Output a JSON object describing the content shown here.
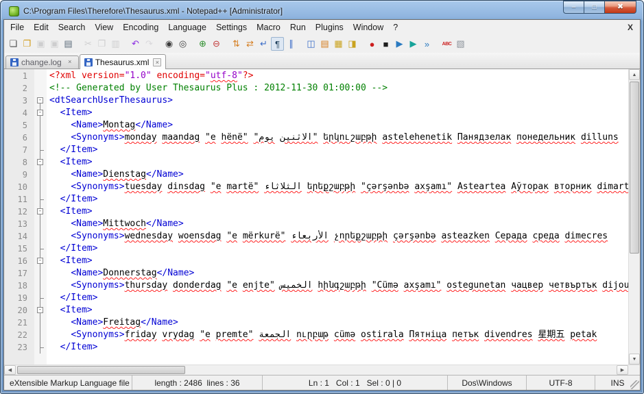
{
  "window": {
    "title": "C:\\Program Files\\Therefore\\Thesaurus.xml - Notepad++ [Administrator]"
  },
  "titlebar": {
    "buttons": [
      {
        "name": "minimize-button",
        "glyph": "–",
        "cls": "min"
      },
      {
        "name": "maximize-button",
        "glyph": "□",
        "cls": "max"
      },
      {
        "name": "close-button",
        "glyph": "✖",
        "cls": "close"
      }
    ]
  },
  "menu": {
    "items": [
      "File",
      "Edit",
      "Search",
      "View",
      "Encoding",
      "Language",
      "Settings",
      "Macro",
      "Run",
      "Plugins",
      "Window",
      "?"
    ],
    "close_document_label": "X"
  },
  "toolbar": {
    "icons": [
      {
        "n": "new-file-icon",
        "g": "❏",
        "c": "#4a4a4a"
      },
      {
        "n": "open-folder-icon",
        "g": "❐",
        "c": "#d29b18"
      },
      {
        "n": "save-icon",
        "g": "▣",
        "c": "#9aa2ac",
        "d": 1
      },
      {
        "n": "save-all-icon",
        "g": "▣",
        "c": "#9aa2ac",
        "d": 1
      },
      {
        "n": "print-icon",
        "g": "▤",
        "c": "#5d6d7c"
      },
      {
        "sep": 1
      },
      {
        "n": "cut-icon",
        "g": "✂",
        "c": "#9aa2ac",
        "d": 1
      },
      {
        "n": "copy-icon",
        "g": "❐",
        "c": "#9aa2ac",
        "d": 1
      },
      {
        "n": "paste-icon",
        "g": "▥",
        "c": "#9aa2ac",
        "d": 1
      },
      {
        "sep": 1
      },
      {
        "n": "undo-icon",
        "g": "↶",
        "c": "#8a2be2"
      },
      {
        "n": "redo-icon",
        "g": "↷",
        "c": "#c5b3e6",
        "d": 1
      },
      {
        "sep": 1
      },
      {
        "n": "find-icon",
        "g": "◉",
        "c": "#3b3b3b"
      },
      {
        "n": "replace-icon",
        "g": "◎",
        "c": "#3b3b3b"
      },
      {
        "sep": 1
      },
      {
        "n": "zoom-in-icon",
        "g": "⊕",
        "c": "#2f8f2f"
      },
      {
        "n": "zoom-out-icon",
        "g": "⊖",
        "c": "#c23a3a"
      },
      {
        "sep": 1
      },
      {
        "n": "sync-vertical-scroll-icon",
        "g": "⇅",
        "c": "#d57d1f"
      },
      {
        "n": "sync-horizontal-scroll-icon",
        "g": "⇄",
        "c": "#d57d1f"
      },
      {
        "n": "word-wrap-icon",
        "g": "↵",
        "c": "#3a6cc8"
      },
      {
        "n": "show-all-characters-icon",
        "g": "¶",
        "c": "#23425e",
        "p": 1
      },
      {
        "n": "indent-guide-icon",
        "g": "∥",
        "c": "#3a6cc8"
      },
      {
        "sep": 1
      },
      {
        "n": "doc-map-icon",
        "g": "◫",
        "c": "#3a6cc8"
      },
      {
        "n": "function-list-icon",
        "g": "▤",
        "c": "#d57d1f"
      },
      {
        "n": "file-browser-icon",
        "g": "▦",
        "c": "#caa31e"
      },
      {
        "n": "monitor-icon",
        "g": "◨",
        "c": "#caa31e"
      },
      {
        "sep": 1
      },
      {
        "n": "record-macro-icon",
        "g": "●",
        "c": "#cc1f1f"
      },
      {
        "n": "stop-macro-icon",
        "g": "■",
        "c": "#1f1f1f"
      },
      {
        "n": "play-macro-icon",
        "g": "▶",
        "c": "#2a7ac0"
      },
      {
        "n": "save-macro-icon",
        "g": "▶",
        "c": "#18a39a"
      },
      {
        "n": "run-macro-multiple-icon",
        "g": "»",
        "c": "#2a7ac0"
      },
      {
        "sep": 1
      },
      {
        "n": "spell-check-icon",
        "g": "ABC",
        "c": "#cc1f1f",
        "abc": 1
      },
      {
        "n": "plugin-icon",
        "g": "▧",
        "c": "#8d949c"
      }
    ]
  },
  "tabs": {
    "close_glyph": "×",
    "items": [
      {
        "label": "change.log",
        "active": false
      },
      {
        "label": "Thesaurus.xml",
        "active": true
      }
    ]
  },
  "scrollbar": {
    "up": "▲",
    "down": "▼",
    "left": "◀",
    "right": "▶"
  },
  "editor": {
    "lines": [
      {
        "n": 1,
        "f": "",
        "seg": [
          {
            "s": "dec",
            "t": "<?xml version="
          },
          {
            "s": "str",
            "t": "\"1.0\""
          },
          {
            "s": "dec",
            "t": " encoding="
          },
          {
            "s": "str",
            "t": "\""
          },
          {
            "s": "strm",
            "t": "utf-8"
          },
          {
            "s": "str",
            "t": "\""
          },
          {
            "s": "dec",
            "t": "?>"
          }
        ]
      },
      {
        "n": 2,
        "f": "",
        "seg": [
          {
            "s": "com",
            "t": "<!-- Generated by User Thesaurus Plus : 2012-11-30 01:00:00 -->"
          }
        ]
      },
      {
        "n": 3,
        "f": "boxtop",
        "seg": [
          {
            "s": "tag",
            "t": "<dtSearchUserThesaurus>"
          }
        ]
      },
      {
        "n": 4,
        "f": "box",
        "seg": [
          {
            "s": "txt",
            "t": "  "
          },
          {
            "s": "tag",
            "t": "<Item>"
          }
        ]
      },
      {
        "n": 5,
        "f": "line",
        "seg": [
          {
            "s": "txt",
            "t": "    "
          },
          {
            "s": "tag",
            "t": "<Name>"
          },
          {
            "s": "mis",
            "t": "Montag"
          },
          {
            "s": "tag",
            "t": "</Name>"
          }
        ]
      },
      {
        "n": 6,
        "f": "line",
        "seg": [
          {
            "s": "txt",
            "t": "    "
          },
          {
            "s": "tag",
            "t": "<Synonyms>"
          },
          {
            "s": "mis",
            "t": "monday maandag \"e hënë\" \"يوم الاثنين\" երկուշաբթի astelehenetik Панядзелак понедельник dilluns"
          }
        ]
      },
      {
        "n": 7,
        "f": "end",
        "seg": [
          {
            "s": "txt",
            "t": "  "
          },
          {
            "s": "tag",
            "t": "</Item>"
          }
        ]
      },
      {
        "n": 8,
        "f": "box",
        "seg": [
          {
            "s": "txt",
            "t": "  "
          },
          {
            "s": "tag",
            "t": "<Item>"
          }
        ]
      },
      {
        "n": 9,
        "f": "line",
        "seg": [
          {
            "s": "txt",
            "t": "    "
          },
          {
            "s": "tag",
            "t": "<Name>"
          },
          {
            "s": "mis",
            "t": "Dienstag"
          },
          {
            "s": "tag",
            "t": "</Name>"
          }
        ]
      },
      {
        "n": 10,
        "f": "line",
        "seg": [
          {
            "s": "txt",
            "t": "    "
          },
          {
            "s": "tag",
            "t": "<Synonyms>"
          },
          {
            "s": "mis",
            "t": "tuesday dinsdag \"e martë\" الثلاثاء երեքշաբթի \"çərşənbə axşamı\" Asteartea Аўторак вторник dimarts"
          }
        ]
      },
      {
        "n": 11,
        "f": "end",
        "seg": [
          {
            "s": "txt",
            "t": "  "
          },
          {
            "s": "tag",
            "t": "</Item>"
          }
        ]
      },
      {
        "n": 12,
        "f": "box",
        "seg": [
          {
            "s": "txt",
            "t": "  "
          },
          {
            "s": "tag",
            "t": "<Item>"
          }
        ]
      },
      {
        "n": 13,
        "f": "line",
        "seg": [
          {
            "s": "txt",
            "t": "    "
          },
          {
            "s": "tag",
            "t": "<Name>"
          },
          {
            "s": "mis",
            "t": "Mittwoch"
          },
          {
            "s": "tag",
            "t": "</Name>"
          }
        ]
      },
      {
        "n": 14,
        "f": "line",
        "seg": [
          {
            "s": "txt",
            "t": "    "
          },
          {
            "s": "tag",
            "t": "<Synonyms>"
          },
          {
            "s": "mis",
            "t": "wednesday woensdag \"e mërkurë\" الأربعاء չորեքշաբթի çərşənbə asteazken Серада среда dimecres"
          }
        ]
      },
      {
        "n": 15,
        "f": "end",
        "seg": [
          {
            "s": "txt",
            "t": "  "
          },
          {
            "s": "tag",
            "t": "</Item>"
          }
        ]
      },
      {
        "n": 16,
        "f": "box",
        "seg": [
          {
            "s": "txt",
            "t": "  "
          },
          {
            "s": "tag",
            "t": "<Item>"
          }
        ]
      },
      {
        "n": 17,
        "f": "line",
        "seg": [
          {
            "s": "txt",
            "t": "    "
          },
          {
            "s": "tag",
            "t": "<Name>"
          },
          {
            "s": "mis",
            "t": "Donnerstag"
          },
          {
            "s": "tag",
            "t": "</Name>"
          }
        ]
      },
      {
        "n": 18,
        "f": "line",
        "seg": [
          {
            "s": "txt",
            "t": "    "
          },
          {
            "s": "tag",
            "t": "<Synonyms>"
          },
          {
            "s": "mis",
            "t": "thursday donderdag \"e enjte\" الخميس հինգշաբթի \"Cümə axşamı\" ostegunetan чацвер четвъртък dijous"
          }
        ]
      },
      {
        "n": 19,
        "f": "end",
        "seg": [
          {
            "s": "txt",
            "t": "  "
          },
          {
            "s": "tag",
            "t": "</Item>"
          }
        ]
      },
      {
        "n": 20,
        "f": "box",
        "seg": [
          {
            "s": "txt",
            "t": "  "
          },
          {
            "s": "tag",
            "t": "<Item>"
          }
        ]
      },
      {
        "n": 21,
        "f": "line",
        "seg": [
          {
            "s": "txt",
            "t": "    "
          },
          {
            "s": "tag",
            "t": "<Name>"
          },
          {
            "s": "mis",
            "t": "Freitag"
          },
          {
            "s": "tag",
            "t": "</Name>"
          }
        ]
      },
      {
        "n": 22,
        "f": "line",
        "seg": [
          {
            "s": "txt",
            "t": "    "
          },
          {
            "s": "tag",
            "t": "<Synonyms>"
          },
          {
            "s": "mis",
            "t": "friday vrydag \"e premte\" الجمعة ուրբաթ cümə ostirala Пятніца петък divendres 星期五 petak"
          }
        ]
      },
      {
        "n": 23,
        "f": "end",
        "seg": [
          {
            "s": "txt",
            "t": "  "
          },
          {
            "s": "tag",
            "t": "</Item>"
          }
        ]
      }
    ]
  },
  "statusbar": {
    "doc_type": "eXtensible Markup Language file",
    "length_lines": "length : 2486  lines : 36",
    "position": "Ln : 1   Col : 1   Sel : 0 | 0",
    "eol": "Dos\\Windows",
    "encoding": "UTF-8",
    "typing_mode": "INS"
  },
  "colors": {
    "titlebar_blue": "#8fb4de",
    "window_border": "#24415f",
    "close_red": "#c23a18",
    "syntax": {
      "tag": "#0000d4",
      "comment": "#008000",
      "declaration": "#e00000",
      "string": "#9400c8",
      "text": "#000000",
      "misspell_underline": "#ff2020"
    }
  }
}
